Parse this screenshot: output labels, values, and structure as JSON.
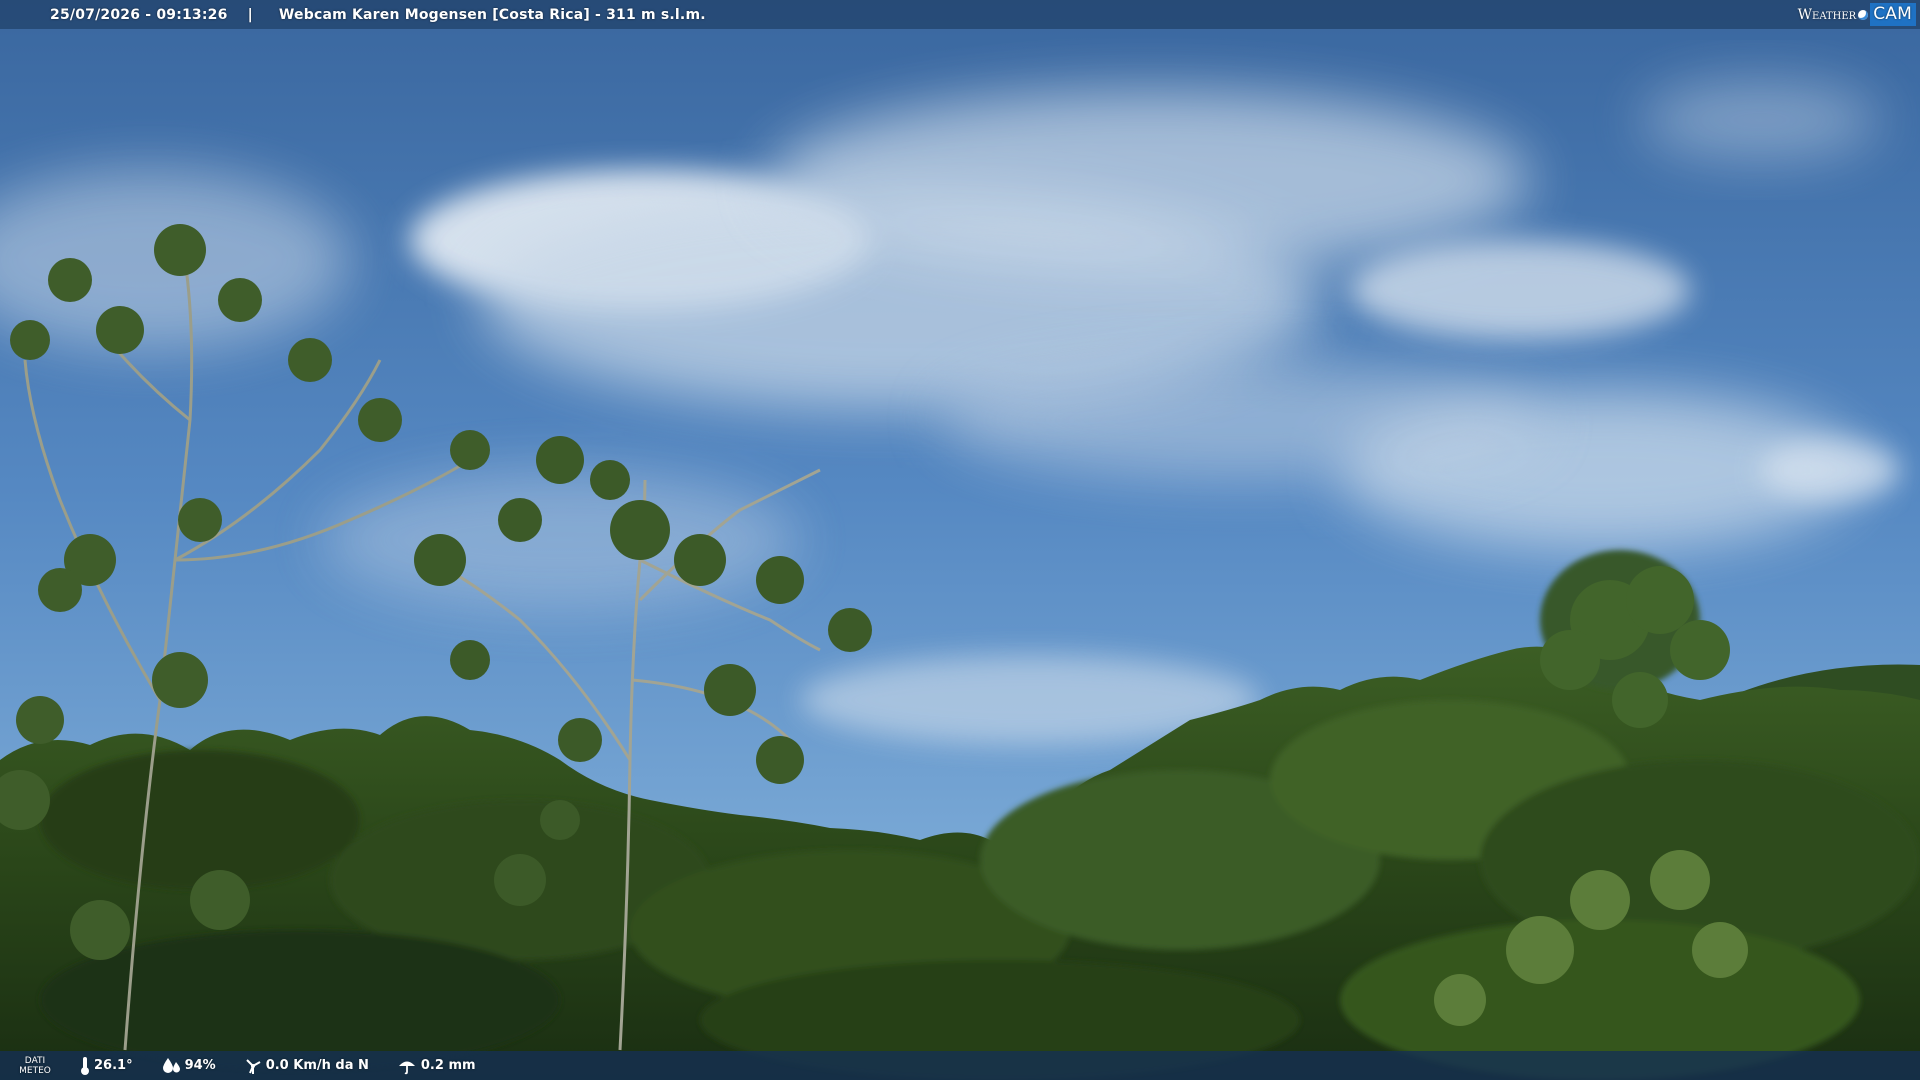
{
  "header": {
    "datetime": "25/07/2026 - 09:13:26",
    "separator": "|",
    "title": "Webcam Karen Mogensen [Costa Rica]  - 311 m s.l.m.",
    "brand_weather": "Weather",
    "brand_cam": "CAM"
  },
  "footer": {
    "meteo_label_line1": "DATI",
    "meteo_label_line2": "METEO",
    "temperature": "26.1°",
    "humidity": "94%",
    "wind": "0.0 Km/h da N",
    "rain": "0.2 mm"
  },
  "icons": {
    "temperature": "thermometer-icon",
    "humidity": "humidity-drops-icon",
    "wind": "wind-icon",
    "rain": "rain-icon"
  },
  "colors": {
    "sky_top": "#3d6fa8",
    "sky_bottom": "#6a9ed0",
    "cloud": "#dfe8f1",
    "forest_dark": "#1c3315",
    "forest_mid": "#34561f",
    "brand_blue": "#1f72c4"
  }
}
